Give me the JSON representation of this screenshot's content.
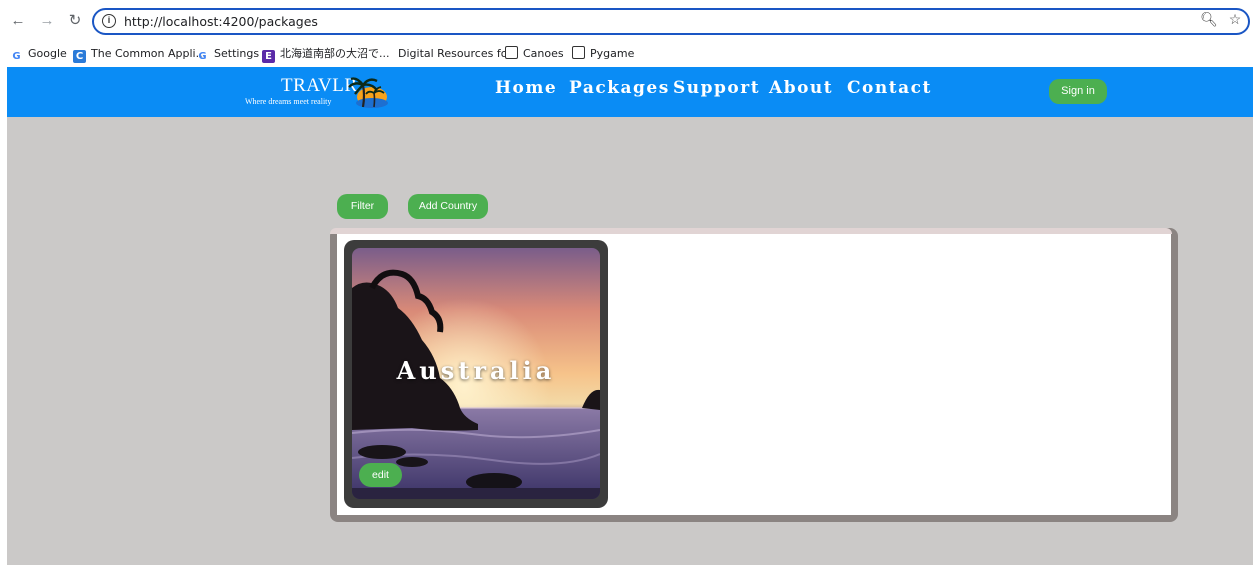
{
  "browser": {
    "url": "http://localhost:4200/packages",
    "bookmarks": [
      {
        "label": "Google"
      },
      {
        "label": "The Common Appli..."
      },
      {
        "label": "Settings"
      },
      {
        "label": "北海道南部の大沼で..."
      },
      {
        "label": "Digital Resources fo..."
      },
      {
        "label": "Canoes"
      },
      {
        "label": "Pygame"
      }
    ]
  },
  "header": {
    "logo_title": "TRAVLR",
    "logo_tagline": "Where dreams meet reality",
    "nav": [
      "Home",
      "Packages",
      "Support",
      "About",
      "Contact"
    ],
    "sign_in": "Sign in",
    "color": "#0a8cf5"
  },
  "toolbar": {
    "filter": "Filter",
    "add_country": "Add Country"
  },
  "cards": [
    {
      "title": "Australia",
      "edit_label": "edit"
    }
  ],
  "colors": {
    "accent_green": "#4caf50",
    "page_bg": "#cbc9c8"
  }
}
